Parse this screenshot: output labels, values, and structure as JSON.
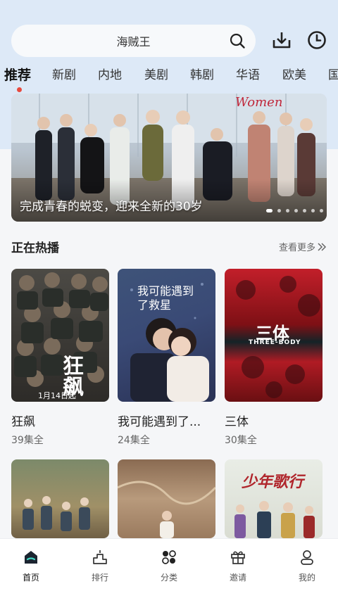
{
  "search": {
    "query": "海贼王"
  },
  "tabs": [
    "推荐",
    "新剧",
    "内地",
    "美剧",
    "韩剧",
    "华语",
    "欧美",
    "国"
  ],
  "banner": {
    "caption": "完成青春的蜕变，迎来全新的30岁",
    "slide_count": 7,
    "active_slide": 1
  },
  "hot": {
    "title": "正在热播",
    "more_label": "查看更多",
    "items": [
      {
        "title": "狂飙",
        "episodes": "39集全",
        "poster_text": "狂飙",
        "poster_date": "1月14日起"
      },
      {
        "title": "我可能遇到了...",
        "episodes": "24集全",
        "poster_text": "我可能遇到了救星"
      },
      {
        "title": "三体",
        "episodes": "30集全",
        "poster_text": "三体",
        "poster_sub": "THREE-BODY"
      }
    ],
    "row2_poster_text": "少年歌行"
  },
  "nav": {
    "items": [
      {
        "label": "首页",
        "icon": "home-icon",
        "active": true
      },
      {
        "label": "排行",
        "icon": "ranking-icon"
      },
      {
        "label": "分类",
        "icon": "category-icon"
      },
      {
        "label": "邀请",
        "icon": "gift-icon"
      },
      {
        "label": "我的",
        "icon": "profile-icon"
      }
    ]
  },
  "colors": {
    "accent_dot": "#e84a3d",
    "header_bg": "#dde9f7"
  }
}
